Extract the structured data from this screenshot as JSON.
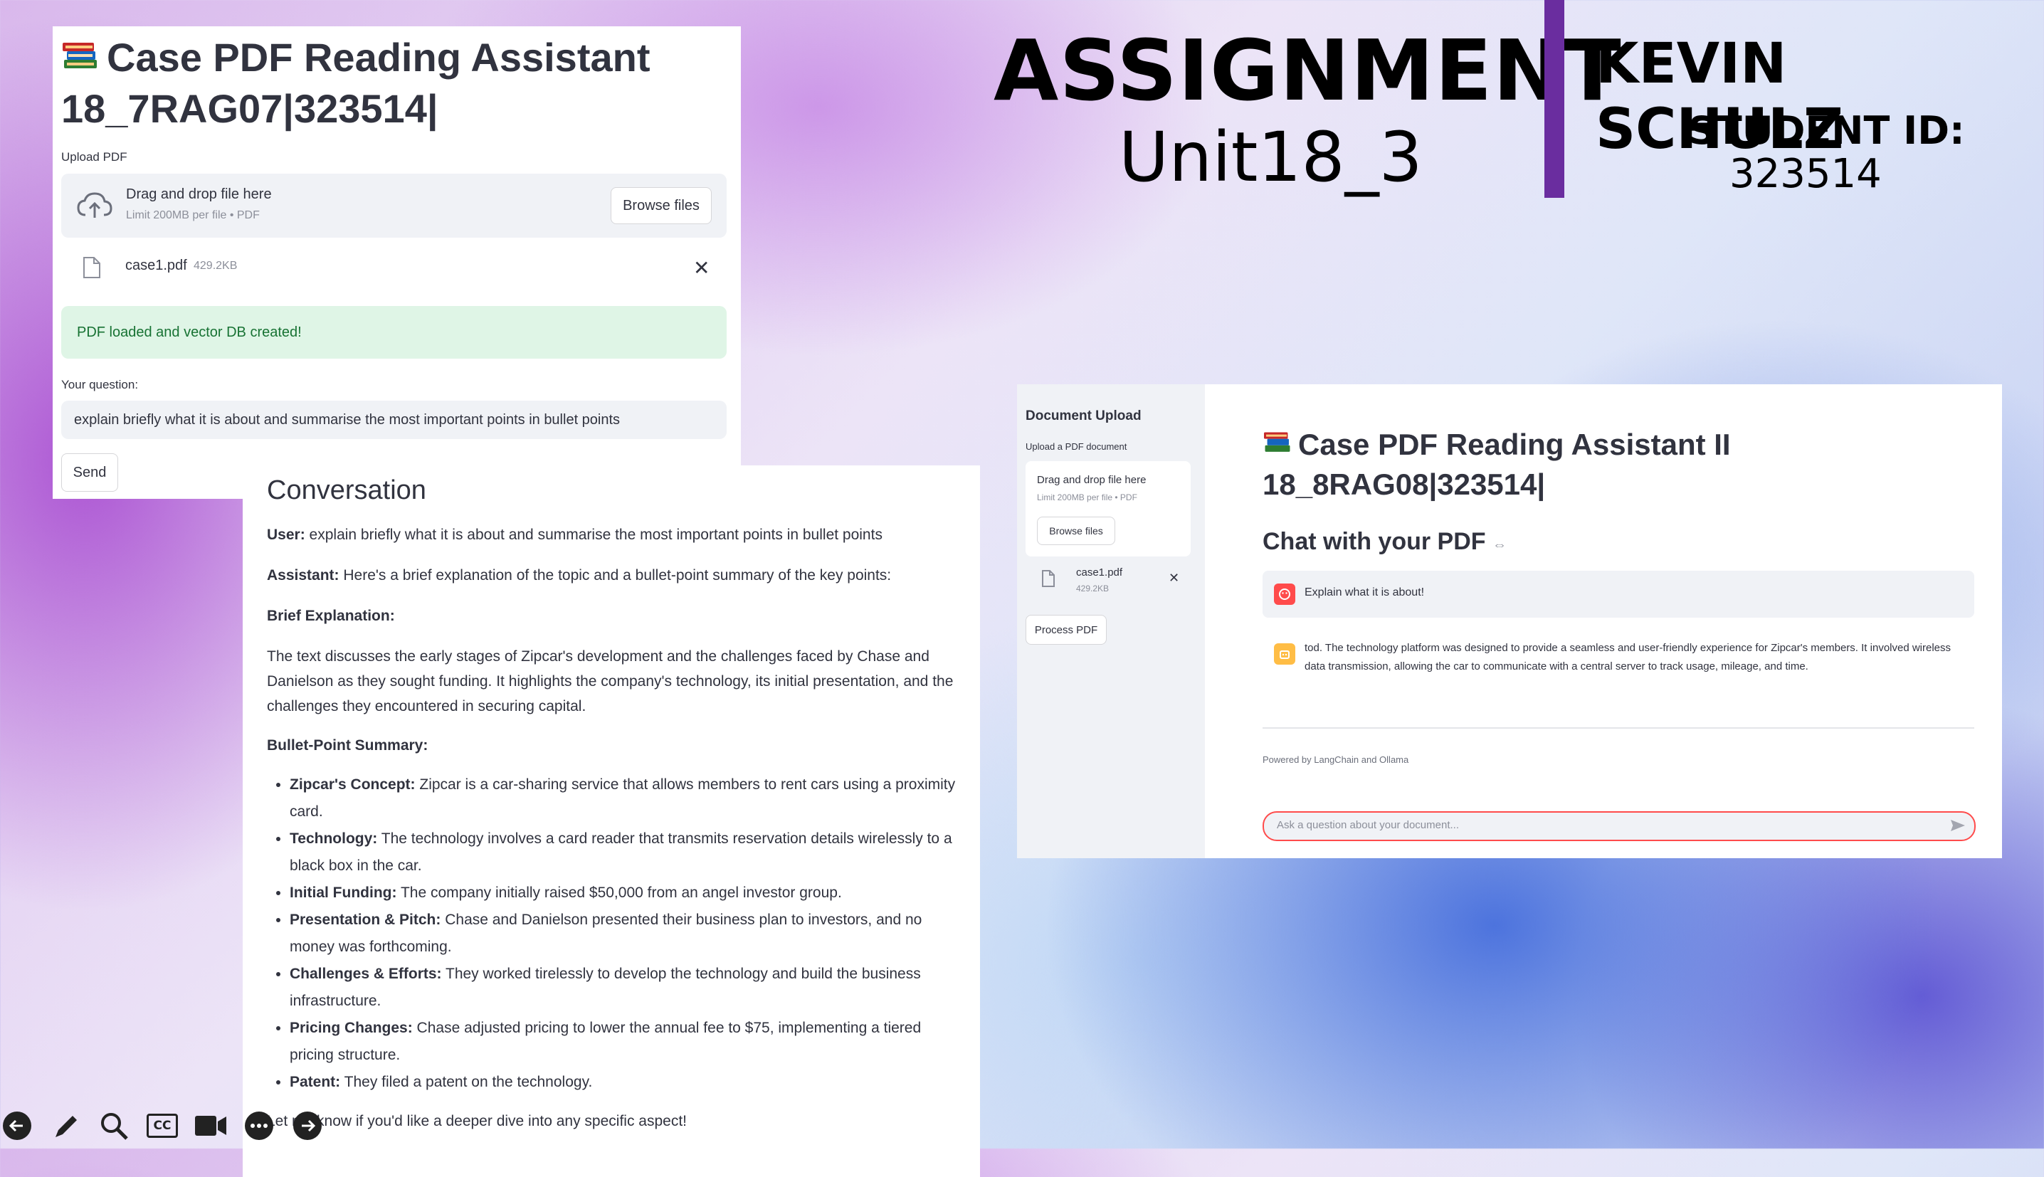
{
  "assignment": {
    "title": "ASSIGNMENT",
    "unit": "Unit18_3",
    "name": "KEVIN SCHULZ",
    "student_id_label": "STUDENT ID:",
    "student_id": "323514"
  },
  "panel1": {
    "title_line1": "Case PDF Reading Assistant",
    "title_line2": "18_7RAG07|323514|",
    "upload_label": "Upload PDF",
    "drop_text": "Drag and drop file here",
    "drop_limit": "Limit 200MB per file • PDF",
    "browse_label": "Browse files",
    "file_name": "case1.pdf",
    "file_size": "429.2KB",
    "success_msg": "PDF loaded and vector DB created!",
    "question_label": "Your question:",
    "question_value": "explain briefly what it is about and summarise the most important points in bullet points",
    "send_label": "Send"
  },
  "conversation": {
    "heading": "Conversation",
    "user_label": "User:",
    "user_text": "explain briefly what it is about and summarise the most important points in bullet points",
    "assistant_label": "Assistant:",
    "assistant_text": "Here's a brief explanation of the topic and a bullet-point summary of the key points:",
    "brief_heading": "Brief Explanation:",
    "brief_text": "The text discusses the early stages of Zipcar's development and the challenges faced by Chase and Danielson as they sought funding. It highlights the company's technology, its initial presentation, and the challenges they encountered in securing capital.",
    "bullet_heading": "Bullet-Point Summary:",
    "bullets": [
      {
        "bold": "Zipcar's Concept:",
        "text": "Zipcar is a car-sharing service that allows members to rent cars using a proximity card."
      },
      {
        "bold": "Technology:",
        "text": "The technology involves a card reader that transmits reservation details wirelessly to a black box in the car."
      },
      {
        "bold": "Initial Funding:",
        "text": "The company initially raised $50,000 from an angel investor group."
      },
      {
        "bold": "Presentation & Pitch:",
        "text": "Chase and Danielson presented their business plan to investors, and no money was forthcoming."
      },
      {
        "bold": "Challenges & Efforts:",
        "text": "They worked tirelessly to develop the technology and build the business infrastructure."
      },
      {
        "bold": "Pricing Changes:",
        "text": "Chase adjusted pricing to lower the annual fee to $75, implementing a tiered pricing structure."
      },
      {
        "bold": "Patent:",
        "text": "They filed a patent on the technology."
      }
    ],
    "closing": "Let me know if you'd like a deeper dive into any specific aspect!"
  },
  "panel3": {
    "sidebar_title": "Document Upload",
    "upload_label": "Upload a PDF document",
    "drop_text": "Drag and drop file here",
    "drop_limit": "Limit 200MB per file • PDF",
    "browse_label": "Browse files",
    "file_name": "case1.pdf",
    "file_size": "429.2KB",
    "process_label": "Process PDF",
    "title_line1": "Case PDF Reading Assistant II",
    "title_line2": "18_8RAG08|323514|",
    "chat_heading": "Chat with your PDF",
    "user_msg": "Explain what it is about!",
    "assistant_msg": "tod. The technology platform was designed to provide a seamless and user-friendly experience for Zipcar's members. It involved wireless data transmission, allowing the car to communicate with a central server to track usage, mileage, and time.",
    "powered_by": "Powered by LangChain and Ollama",
    "chat_placeholder": "Ask a question about your document..."
  },
  "toolbar": {
    "icons": [
      "back-arrow-icon",
      "pen-icon",
      "zoom-icon",
      "cc-icon",
      "camera-icon",
      "more-icon",
      "forward-arrow-icon"
    ],
    "cc_text": "CC"
  },
  "colors": {
    "purple_bar": "#6a2d9f",
    "success_bg": "#dff5e6",
    "success_text": "#177233",
    "user_avatar": "#ff4b4b",
    "assistant_avatar": "#ffbd45"
  }
}
